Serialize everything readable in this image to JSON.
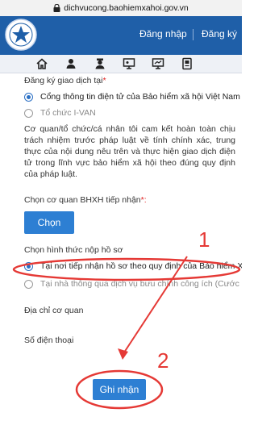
{
  "browser": {
    "url": "dichvucong.baohiemxahoi.gov.vn"
  },
  "header": {
    "login": "Đăng nhập",
    "register": "Đăng ký"
  },
  "nav_icons": [
    "home-icon",
    "user-group-icon",
    "officer-icon",
    "presentation-icon",
    "monitor-icon",
    "document-icon"
  ],
  "colors": {
    "header": "#1f5fa8",
    "button": "#2d7fd3",
    "annotation": "#e53935"
  },
  "form": {
    "register_label": "Đăng ký giao dịch tại",
    "required_mark": "*",
    "register_options": [
      {
        "label": "Cổng thông tin điện tử của Bảo hiểm xã hội Việt Nam",
        "selected": true
      },
      {
        "label": "Tổ chức I-VAN",
        "selected": false
      }
    ],
    "commitment_text": "Cơ quan/tổ chức/cá nhân tôi cam kết hoàn toàn chịu trách nhiệm trước pháp luật về tính chính xác, trung thực của nội dung nêu trên và thực hiện giao dịch điện tử trong lĩnh vực bảo hiểm xã hội theo đúng quy định của pháp luật.",
    "agency_label": "Chọn cơ quan BHXH tiếp nhận",
    "agency_required_mark": "*:",
    "choose_button": "Chọn",
    "submit_method_label": "Chọn hình thức nộp hồ sơ",
    "submit_options": [
      {
        "label": "Tại nơi tiếp nhận hồ sơ theo quy định của Bảo hiểm Xã",
        "selected": true
      },
      {
        "label": "Tại nhà thông qua dịch vụ bưu chính công ích (Cước d",
        "selected": false
      }
    ],
    "agency_address_label": "Địa chỉ cơ quan",
    "phone_label": "Số điện thoại",
    "submit_button": "Ghi nhận"
  },
  "annotations": {
    "step1": "1",
    "step2": "2"
  }
}
